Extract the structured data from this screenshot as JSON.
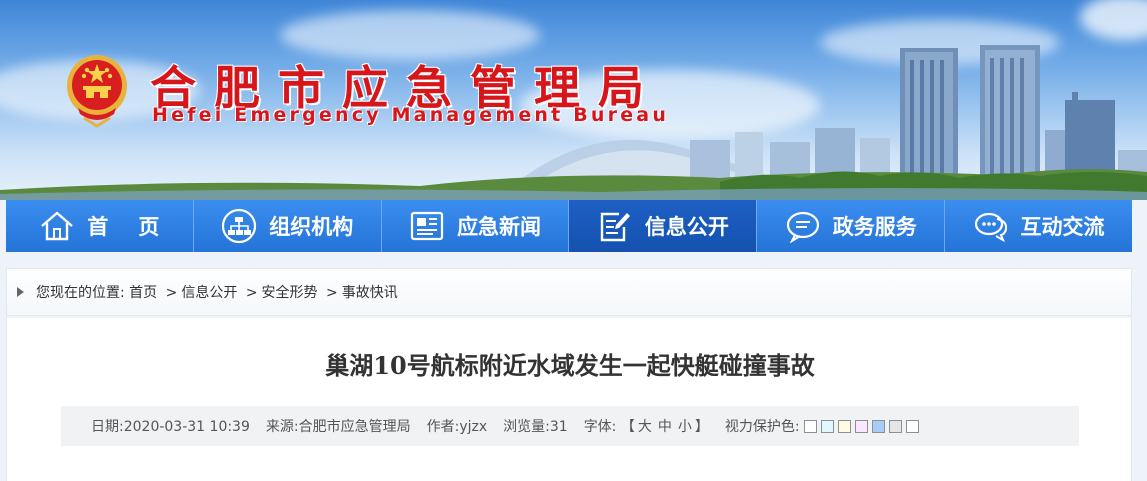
{
  "header": {
    "title_cn": "合肥市应急管理局",
    "title_en": "Hefei Emergency Management Bureau"
  },
  "nav": {
    "items": [
      {
        "label": "首页",
        "icon": "home-icon"
      },
      {
        "label": "组织机构",
        "icon": "org-chart-icon"
      },
      {
        "label": "应急新闻",
        "icon": "newspaper-icon"
      },
      {
        "label": "信息公开",
        "icon": "edit-document-icon"
      },
      {
        "label": "政务服务",
        "icon": "chat-bubble-icon"
      },
      {
        "label": "互动交流",
        "icon": "chat-dots-icon"
      }
    ],
    "active_index": 3
  },
  "breadcrumb": {
    "prefix": "您现在的位置:",
    "items": [
      "首页",
      "信息公开",
      "安全形势",
      "事故快讯"
    ],
    "separator": ">"
  },
  "article": {
    "title": "巢湖10号航标附近水域发生一起快艇碰撞事故",
    "meta": {
      "date_label": "日期:",
      "date": "2020-03-31 10:39",
      "source_label": "来源:",
      "source": "合肥市应急管理局",
      "author_label": "作者:",
      "author": "yjzx",
      "views_label": "浏览量:",
      "views": "31",
      "font_label": "字体:",
      "font_open": "【",
      "font_large": "大",
      "font_medium": "中",
      "font_small": "小",
      "font_close": "】",
      "eye_label": "视力保护色:"
    },
    "eye_colors": [
      "#ffffff",
      "#e3f7ff",
      "#fffbe3",
      "#fbe8ff",
      "#a7cdf6",
      "#e5e5e5",
      "#ffffff"
    ]
  },
  "colors": {
    "brand_red": "#d7161b",
    "nav_blue": "#2574d8",
    "nav_active": "#1552b0"
  }
}
